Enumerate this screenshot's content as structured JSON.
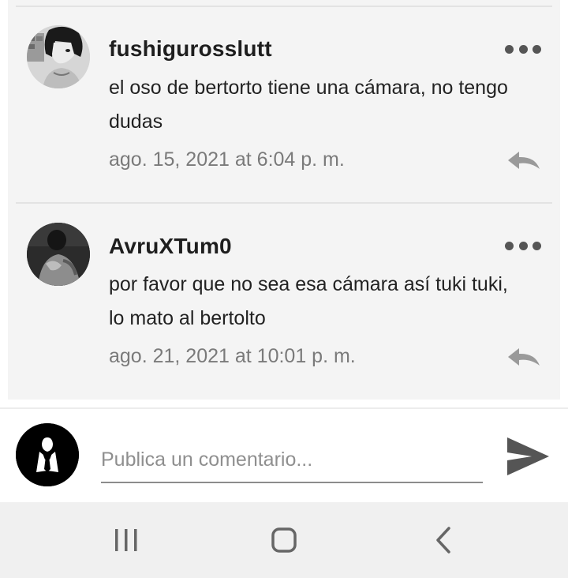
{
  "comments": [
    {
      "username": "fushigurosslutt",
      "text": "el oso de bertorto tiene una cámara, no tengo dudas",
      "timestamp": "ago. 15, 2021 at 6:04 p. m."
    },
    {
      "username": "AvruXTum0",
      "text": "por favor que no sea esa cámara así tuki tuki, lo mato al bertolto",
      "timestamp": "ago. 21, 2021 at 10:01 p. m."
    }
  ],
  "composer": {
    "placeholder": "Publica un comentario..."
  },
  "icons": {
    "more": "more-horizontal-icon",
    "reply": "reply-arrow-icon",
    "send": "send-icon",
    "nav_recents": "recent-apps-icon",
    "nav_home": "home-icon",
    "nav_back": "back-icon"
  },
  "colors": {
    "panel_background": "#f4f4f4",
    "timestamp": "#7a7a7a",
    "icon_gray": "#555555",
    "navbar": "#f0f0f0"
  }
}
